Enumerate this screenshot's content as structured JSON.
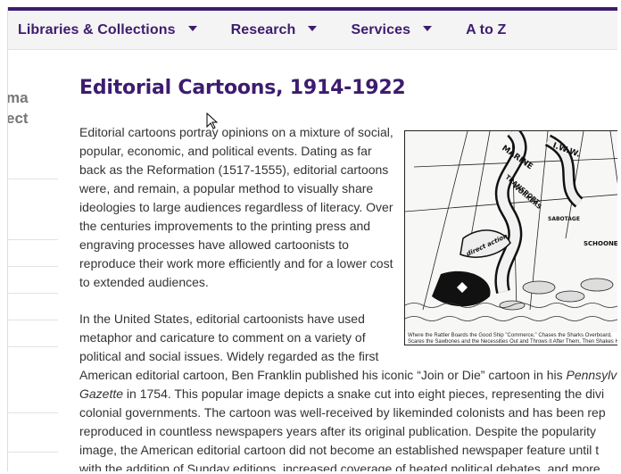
{
  "nav": {
    "items": [
      {
        "label": "Libraries & Collections",
        "has_dropdown": true
      },
      {
        "label": "Research",
        "has_dropdown": true
      },
      {
        "label": "Services",
        "has_dropdown": true
      },
      {
        "label": "A to Z",
        "has_dropdown": false
      }
    ]
  },
  "sidebar": {
    "heading_line1": "ma",
    "heading_line2": "ect"
  },
  "page": {
    "title": "Editorial Cartoons, 1914-1922",
    "para1": "Editorial cartoons portray opinions on a mixture of social, popular, economic, and political events. Dating as far back as the Reformation (1517-1555), editorial cartoons were, and remain, a popular method to visually share ideologies to large audiences regardless of literacy. Over the centuries improvements to the printing press and engraving processes have allowed cartoonists to reproduce their work more efficiently and for a lower cost to extended audiences.",
    "para2_narrow": "In the United States, editorial cartoonists have used metaphor and caricature to comment on a variety of political and social issues. Widely regarded as the first",
    "para2_line4a": "American editorial cartoon, Ben Franklin published his iconic “Join or Die” cartoon in his ",
    "para2_line4b": "Pennsylv",
    "para2_line5a": "Gazette",
    "para2_line5b": " in 1754. This popular image depicts a snake cut into eight pieces, representing the divi",
    "para2_line6": "colonial governments. The cartoon was well-received by likeminded colonists and has been rep",
    "para2_line7": "reproduced in countless newspapers years after its original publication. Despite the popularity",
    "para2_line8": "image, the American editorial cartoon did not become an established newspaper feature until t",
    "para2_line9": "with the addition of Sunday editions, increased coverage of heated political debates, and more"
  },
  "cartoon": {
    "labels": [
      "MARINE",
      "TRANSPORT",
      "WORKERS",
      "I.W.W.",
      "SCHOONER",
      "SABOTAGE",
      "direct action"
    ],
    "caption": "Where the Rattler Boards the Good Ship \"Commerce,\" Chases the Sharks Overboard, Scares the Sawbones and the Necessities Out and Throws it After Them, Then Shakes His Tail in the Face of"
  }
}
